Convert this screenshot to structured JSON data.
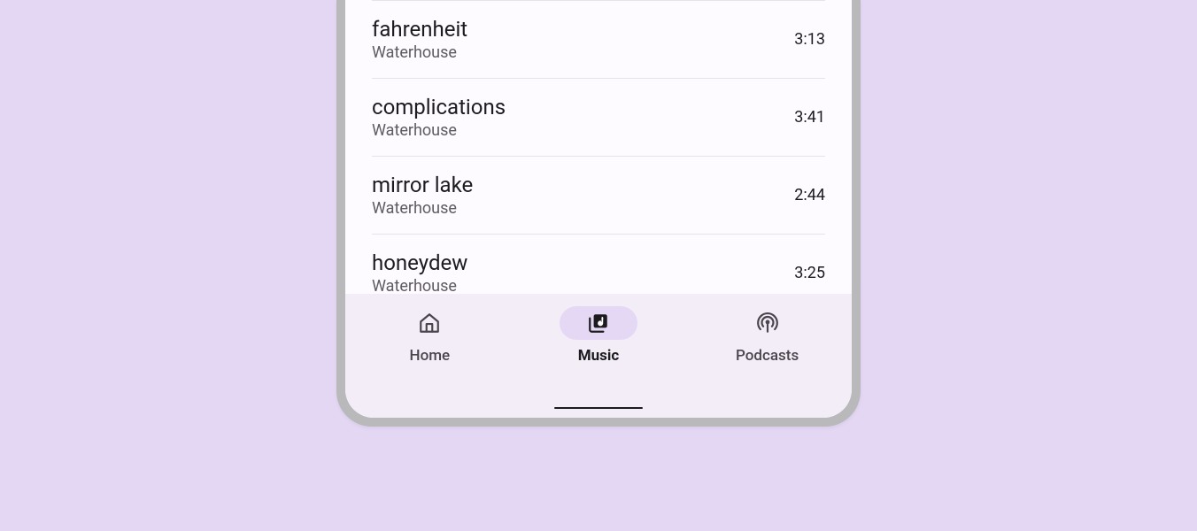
{
  "tracks": [
    {
      "title": "fahrenheit",
      "artist": "Waterhouse",
      "duration": "3:13"
    },
    {
      "title": "complications",
      "artist": "Waterhouse",
      "duration": "3:41"
    },
    {
      "title": "mirror lake",
      "artist": "Waterhouse",
      "duration": "2:44"
    },
    {
      "title": "honeydew",
      "artist": "Waterhouse",
      "duration": "3:25"
    }
  ],
  "nav": {
    "home": {
      "label": "Home",
      "active": false
    },
    "music": {
      "label": "Music",
      "active": true
    },
    "podcasts": {
      "label": "Podcasts",
      "active": false
    }
  }
}
